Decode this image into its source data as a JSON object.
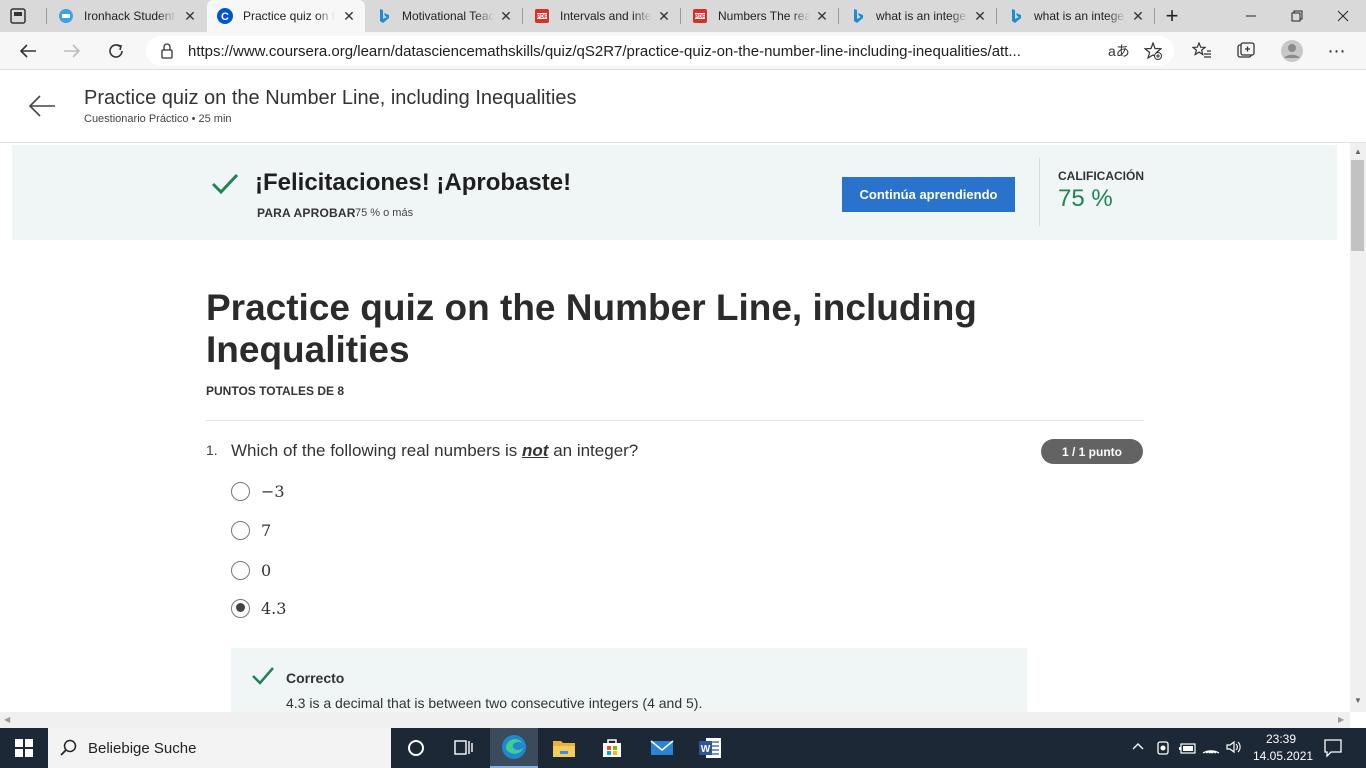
{
  "browser": {
    "tabs": [
      {
        "label": "Ironhack Student",
        "icon": "ironhack-icon",
        "active": false
      },
      {
        "label": "Practice quiz on t",
        "icon": "coursera-icon",
        "active": true
      },
      {
        "label": "Motivational Teac",
        "icon": "bing-icon",
        "active": false
      },
      {
        "label": "Intervals and inte",
        "icon": "pdf-icon",
        "active": false
      },
      {
        "label": "Numbers The rea",
        "icon": "pdf-icon",
        "active": false
      },
      {
        "label": "what is an intege",
        "icon": "bing-icon",
        "active": false
      },
      {
        "label": "what is an intege",
        "icon": "bing-icon",
        "active": false
      }
    ],
    "url": "https://www.coursera.org/learn/datasciencemathskills/quiz/qS2R7/practice-quiz-on-the-number-line-including-inequalities/att..."
  },
  "header": {
    "title": "Practice quiz on the Number Line, including Inequalities",
    "subtitle": "Cuestionario Práctico • 25 min"
  },
  "banner": {
    "title": "¡Felicitaciones! ¡Aprobaste!",
    "pass_label": "PARA APROBAR",
    "pass_value": "75 % o más",
    "continue_label": "Continúa aprendiendo",
    "grade_label": "CALIFICACIÓN",
    "grade_value": "75 %",
    "accent": "#2a73cc",
    "success": "#1f8354"
  },
  "quiz": {
    "title": "Practice quiz on the Number Line, including Inequalities",
    "points_total": "PUNTOS TOTALES DE 8",
    "question": {
      "number": "1.",
      "text_before": "Which of the following real numbers is ",
      "text_emph": "not",
      "text_after": " an integer?",
      "score": "1 / 1 punto",
      "options": [
        {
          "label": "−3",
          "selected": false
        },
        {
          "label": "7",
          "selected": false
        },
        {
          "label": "0",
          "selected": false
        },
        {
          "label": "4.3",
          "selected": true
        }
      ],
      "feedback_title": "Correcto",
      "feedback_text": "4.3 is a decimal that is between two consecutive integers (4 and 5)."
    }
  },
  "taskbar": {
    "search_placeholder": "Beliebige Suche",
    "time": "23:39",
    "date": "14.05.2021"
  }
}
